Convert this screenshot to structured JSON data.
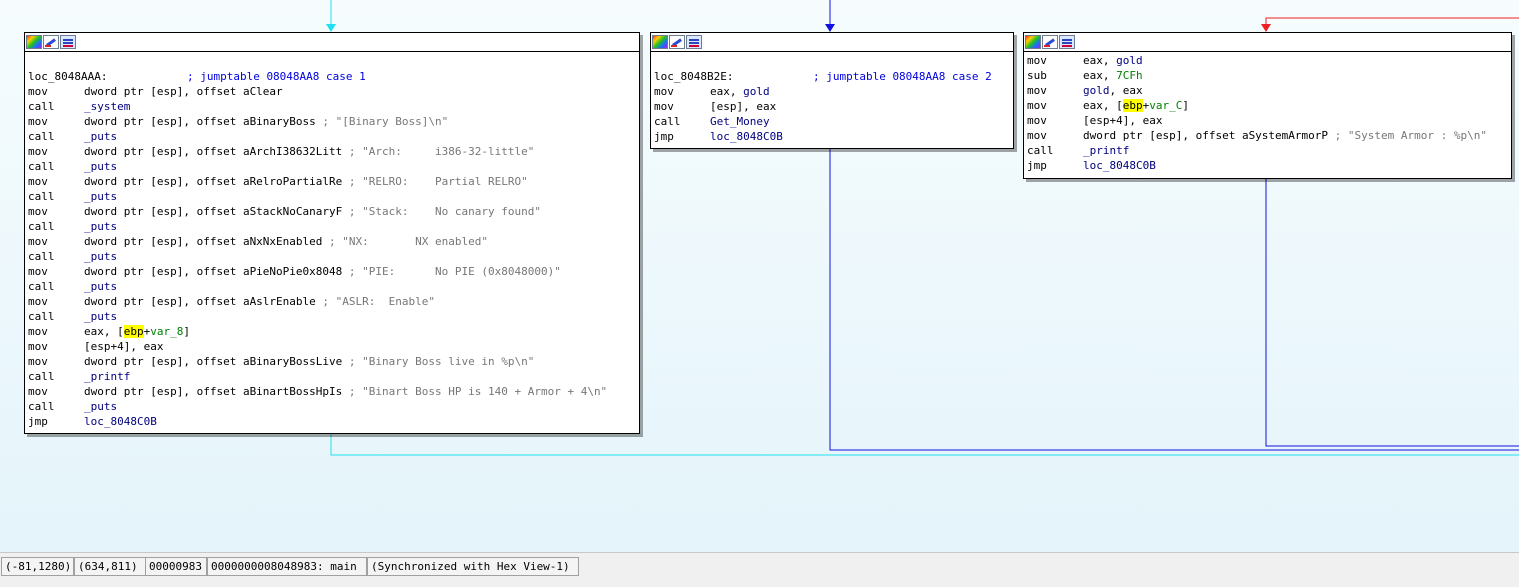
{
  "nodes": [
    {
      "id": "case1",
      "lines": [
        [
          {
            "t": " "
          }
        ],
        [
          {
            "t": "loc_8048AAA:",
            "c": "lbl"
          },
          {
            "t": "            "
          },
          {
            "t": "; jumptable 08048AA8 case 1",
            "c": "cmt"
          }
        ],
        [
          {
            "t": "mov",
            "c": "mnem"
          },
          {
            "t": "dword ptr [esp], offset aClear",
            "c": "ops"
          }
        ],
        [
          {
            "t": "call",
            "c": "mnem"
          },
          {
            "t": "_system",
            "c": "sym"
          }
        ],
        [
          {
            "t": "mov",
            "c": "mnem"
          },
          {
            "t": "dword ptr [esp], offset aBinaryBoss",
            "c": "ops"
          },
          {
            "t": " ; \"[Binary Boss]\\n\"",
            "c": "str"
          }
        ],
        [
          {
            "t": "call",
            "c": "mnem"
          },
          {
            "t": "_puts",
            "c": "sym"
          }
        ],
        [
          {
            "t": "mov",
            "c": "mnem"
          },
          {
            "t": "dword ptr [esp], offset aArchI38632Litt",
            "c": "ops"
          },
          {
            "t": " ; \"Arch:     i386-32-little\"",
            "c": "str"
          }
        ],
        [
          {
            "t": "call",
            "c": "mnem"
          },
          {
            "t": "_puts",
            "c": "sym"
          }
        ],
        [
          {
            "t": "mov",
            "c": "mnem"
          },
          {
            "t": "dword ptr [esp], offset aRelroPartialRe",
            "c": "ops"
          },
          {
            "t": " ; \"RELRO:    Partial RELRO\"",
            "c": "str"
          }
        ],
        [
          {
            "t": "call",
            "c": "mnem"
          },
          {
            "t": "_puts",
            "c": "sym"
          }
        ],
        [
          {
            "t": "mov",
            "c": "mnem"
          },
          {
            "t": "dword ptr [esp], offset aStackNoCanaryF",
            "c": "ops"
          },
          {
            "t": " ; \"Stack:    No canary found\"",
            "c": "str"
          }
        ],
        [
          {
            "t": "call",
            "c": "mnem"
          },
          {
            "t": "_puts",
            "c": "sym"
          }
        ],
        [
          {
            "t": "mov",
            "c": "mnem"
          },
          {
            "t": "dword ptr [esp], offset aNxNxEnabled",
            "c": "ops"
          },
          {
            "t": " ; \"NX:       NX enabled\"",
            "c": "str"
          }
        ],
        [
          {
            "t": "call",
            "c": "mnem"
          },
          {
            "t": "_puts",
            "c": "sym"
          }
        ],
        [
          {
            "t": "mov",
            "c": "mnem"
          },
          {
            "t": "dword ptr [esp], offset aPieNoPie0x8048",
            "c": "ops"
          },
          {
            "t": " ; \"PIE:      No PIE (0x8048000)\"",
            "c": "str"
          }
        ],
        [
          {
            "t": "call",
            "c": "mnem"
          },
          {
            "t": "_puts",
            "c": "sym"
          }
        ],
        [
          {
            "t": "mov",
            "c": "mnem"
          },
          {
            "t": "dword ptr [esp], offset aAslrEnable",
            "c": "ops"
          },
          {
            "t": " ; \"ASLR:  Enable\"",
            "c": "str"
          }
        ],
        [
          {
            "t": "call",
            "c": "mnem"
          },
          {
            "t": "_puts",
            "c": "sym"
          }
        ],
        [
          {
            "t": "mov",
            "c": "mnem"
          },
          {
            "t": "eax, [",
            "c": "ops"
          },
          {
            "t": "ebp",
            "c": "hl"
          },
          {
            "t": "+",
            "c": "ops"
          },
          {
            "t": "var_8",
            "c": "var"
          },
          {
            "t": "]",
            "c": "ops"
          }
        ],
        [
          {
            "t": "mov",
            "c": "mnem"
          },
          {
            "t": "[esp+4], eax",
            "c": "ops"
          }
        ],
        [
          {
            "t": "mov",
            "c": "mnem"
          },
          {
            "t": "dword ptr [esp], offset aBinaryBossLive",
            "c": "ops"
          },
          {
            "t": " ; \"Binary Boss live in %p\\n\"",
            "c": "str"
          }
        ],
        [
          {
            "t": "call",
            "c": "mnem"
          },
          {
            "t": "_printf",
            "c": "sym"
          }
        ],
        [
          {
            "t": "mov",
            "c": "mnem"
          },
          {
            "t": "dword ptr [esp], offset aBinartBossHpIs",
            "c": "ops"
          },
          {
            "t": " ; \"Binart Boss HP is 140 + Armor + 4\\n\"",
            "c": "str"
          }
        ],
        [
          {
            "t": "call",
            "c": "mnem"
          },
          {
            "t": "_puts",
            "c": "sym"
          }
        ],
        [
          {
            "t": "jmp",
            "c": "mnem"
          },
          {
            "t": "loc_8048C0B",
            "c": "loc"
          }
        ]
      ]
    },
    {
      "id": "case2",
      "lines": [
        [
          {
            "t": " "
          }
        ],
        [
          {
            "t": "loc_8048B2E:",
            "c": "lbl"
          },
          {
            "t": "            "
          },
          {
            "t": "; jumptable 08048AA8 case 2",
            "c": "cmt"
          }
        ],
        [
          {
            "t": "mov",
            "c": "mnem"
          },
          {
            "t": "eax, ",
            "c": "ops"
          },
          {
            "t": "gold",
            "c": "sym"
          }
        ],
        [
          {
            "t": "mov",
            "c": "mnem"
          },
          {
            "t": "[esp], eax",
            "c": "ops"
          }
        ],
        [
          {
            "t": "call",
            "c": "mnem"
          },
          {
            "t": "Get_Money",
            "c": "sym"
          }
        ],
        [
          {
            "t": "jmp",
            "c": "mnem"
          },
          {
            "t": "loc_8048C0B",
            "c": "loc"
          }
        ]
      ]
    },
    {
      "id": "armor",
      "lines": [
        [
          {
            "t": "mov",
            "c": "mnem"
          },
          {
            "t": "eax, ",
            "c": "ops"
          },
          {
            "t": "gold",
            "c": "sym"
          }
        ],
        [
          {
            "t": "sub",
            "c": "mnem"
          },
          {
            "t": "eax, ",
            "c": "ops"
          },
          {
            "t": "7CFh",
            "c": "num"
          }
        ],
        [
          {
            "t": "mov",
            "c": "mnem"
          },
          {
            "t": "gold",
            "c": "sym"
          },
          {
            "t": ", eax",
            "c": "ops"
          }
        ],
        [
          {
            "t": "mov",
            "c": "mnem"
          },
          {
            "t": "eax, [",
            "c": "ops"
          },
          {
            "t": "ebp",
            "c": "hl"
          },
          {
            "t": "+",
            "c": "ops"
          },
          {
            "t": "var_C",
            "c": "var"
          },
          {
            "t": "]",
            "c": "ops"
          }
        ],
        [
          {
            "t": "mov",
            "c": "mnem"
          },
          {
            "t": "[esp+4], eax",
            "c": "ops"
          }
        ],
        [
          {
            "t": "mov",
            "c": "mnem"
          },
          {
            "t": "dword ptr [esp], offset aSystemArmorP",
            "c": "ops"
          },
          {
            "t": " ; \"System Armor : %p\\n\"",
            "c": "str"
          }
        ],
        [
          {
            "t": "call",
            "c": "mnem"
          },
          {
            "t": "_printf",
            "c": "sym"
          }
        ],
        [
          {
            "t": "jmp",
            "c": "mnem"
          },
          {
            "t": "loc_8048C0B",
            "c": "loc"
          }
        ]
      ]
    }
  ],
  "status": {
    "cursor": "(-81,1280)",
    "coords": "(634,811)",
    "offset": "00000983",
    "address": "0000000008048983: main",
    "sync": "(Synchronized with Hex View-1)"
  },
  "colors": {
    "edge_cyan": "#20e0f0",
    "edge_blue": "#1010e0",
    "edge_red": "#f02020"
  }
}
